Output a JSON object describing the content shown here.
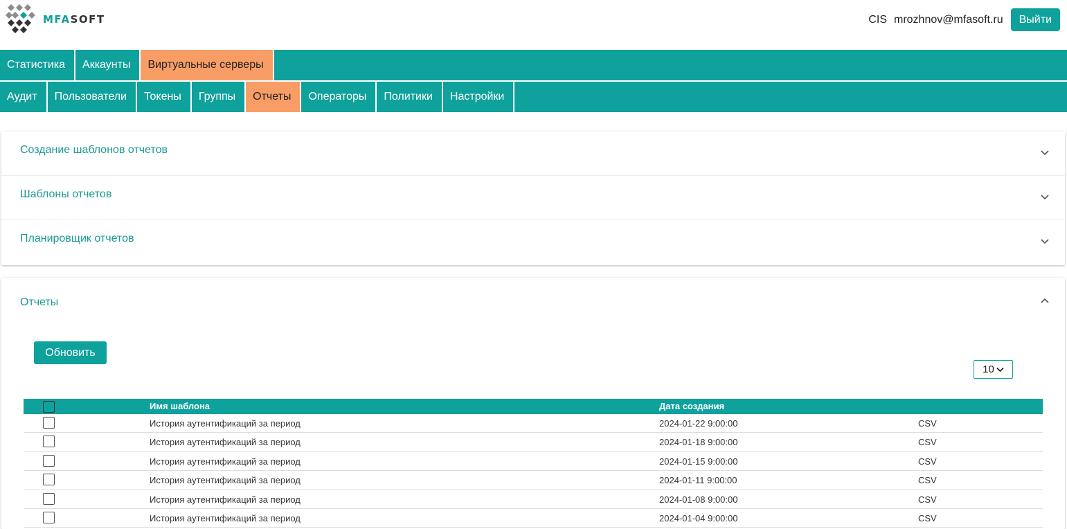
{
  "header": {
    "logo_mfa": "MFA",
    "logo_soft": "SOFT",
    "org": "CIS",
    "email": "mrozhnov@mfasoft.ru",
    "logout_label": "Выйти"
  },
  "nav_primary": [
    {
      "label": "Статистика",
      "active": false
    },
    {
      "label": "Аккаунты",
      "active": false
    },
    {
      "label": "Виртуальные серверы",
      "active": true
    }
  ],
  "nav_secondary": [
    {
      "label": "Аудит",
      "active": false
    },
    {
      "label": "Пользователи",
      "active": false
    },
    {
      "label": "Токены",
      "active": false
    },
    {
      "label": "Группы",
      "active": false
    },
    {
      "label": "Отчеты",
      "active": true
    },
    {
      "label": "Операторы",
      "active": false
    },
    {
      "label": "Политики",
      "active": false
    },
    {
      "label": "Настройки",
      "active": false
    }
  ],
  "accordion": [
    {
      "title": "Создание шаблонов отчетов",
      "icon": "chevron-down-icon"
    },
    {
      "title": "Шаблоны отчетов",
      "icon": "chevron-down-icon"
    },
    {
      "title": "Планировщик отчетов",
      "icon": "chevron-down-icon"
    }
  ],
  "reports": {
    "title": "Отчеты",
    "icon": "chevron-up-icon",
    "refresh_label": "Обновить",
    "page_size": "10",
    "columns": {
      "name": "Имя шаблона",
      "date": "Дата создания",
      "format": ""
    },
    "rows": [
      {
        "name": "История аутентификаций за период",
        "date": "2024-01-22 9:00:00",
        "format": "CSV"
      },
      {
        "name": "История аутентификаций за период",
        "date": "2024-01-18 9:00:00",
        "format": "CSV"
      },
      {
        "name": "История аутентификаций за период",
        "date": "2024-01-15 9:00:00",
        "format": "CSV"
      },
      {
        "name": "История аутентификаций за период",
        "date": "2024-01-11 9:00:00",
        "format": "CSV"
      },
      {
        "name": "История аутентификаций за период",
        "date": "2024-01-08 9:00:00",
        "format": "CSV"
      },
      {
        "name": "История аутентификаций за период",
        "date": "2024-01-04 9:00:00",
        "format": "CSV"
      }
    ]
  },
  "colors": {
    "accent": "#0fa19b",
    "active_tab": "#f99d66"
  }
}
